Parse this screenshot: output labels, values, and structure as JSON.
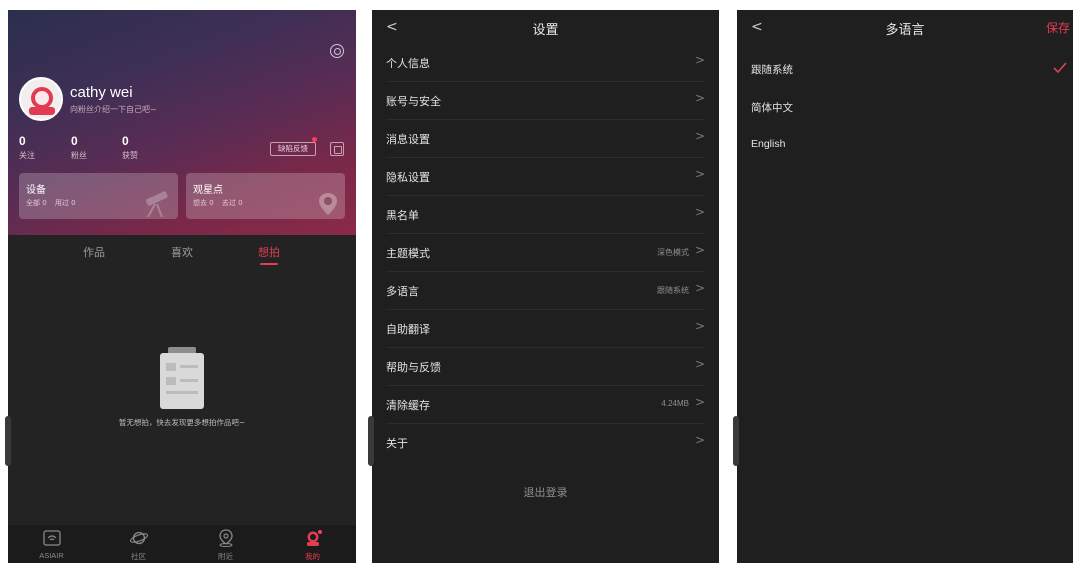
{
  "profile": {
    "user_name": "cathy wei",
    "bio": "向粉丝介绍一下自己吧~",
    "stats": [
      {
        "value": "0",
        "label": "关注"
      },
      {
        "value": "0",
        "label": "粉丝"
      },
      {
        "value": "0",
        "label": "获赞"
      }
    ],
    "feedback_label": "缺陷反馈",
    "cards": [
      {
        "title": "设备",
        "subs": [
          "全部 0",
          "用过 0"
        ],
        "icon": "telescope-icon"
      },
      {
        "title": "观星点",
        "subs": [
          "想去 0",
          "去过 0"
        ],
        "icon": "location-pin-icon"
      }
    ],
    "tabs": [
      "作品",
      "喜欢",
      "想拍"
    ],
    "active_tab": "想拍",
    "empty_text": "暂无想拍，快去发现更多想拍作品吧~",
    "nav": [
      {
        "label": "ASIAIR",
        "icon": "wifi-router-icon"
      },
      {
        "label": "社区",
        "icon": "planet-icon"
      },
      {
        "label": "附近",
        "icon": "location-icon"
      },
      {
        "label": "我的",
        "icon": "astronaut-icon"
      }
    ],
    "accent_color": "#e33d52"
  },
  "settings": {
    "back": "<",
    "title": "设置",
    "rows": [
      {
        "label": "个人信息",
        "value": ""
      },
      {
        "label": "账号与安全",
        "value": ""
      },
      {
        "label": "消息设置",
        "value": ""
      },
      {
        "label": "隐私设置",
        "value": ""
      },
      {
        "label": "黑名单",
        "value": ""
      },
      {
        "label": "主题模式",
        "value": "深色模式"
      },
      {
        "label": "多语言",
        "value": "跟随系统"
      },
      {
        "label": "自助翻译",
        "value": ""
      },
      {
        "label": "帮助与反馈",
        "value": ""
      },
      {
        "label": "清除缓存",
        "value": "4.24MB"
      },
      {
        "label": "关于",
        "value": ""
      }
    ],
    "chevron": ">",
    "logout": "退出登录"
  },
  "language": {
    "back": "<",
    "title": "多语言",
    "save": "保存",
    "options": [
      "跟随系统",
      "简体中文",
      "English"
    ],
    "selected": "跟随系统"
  }
}
